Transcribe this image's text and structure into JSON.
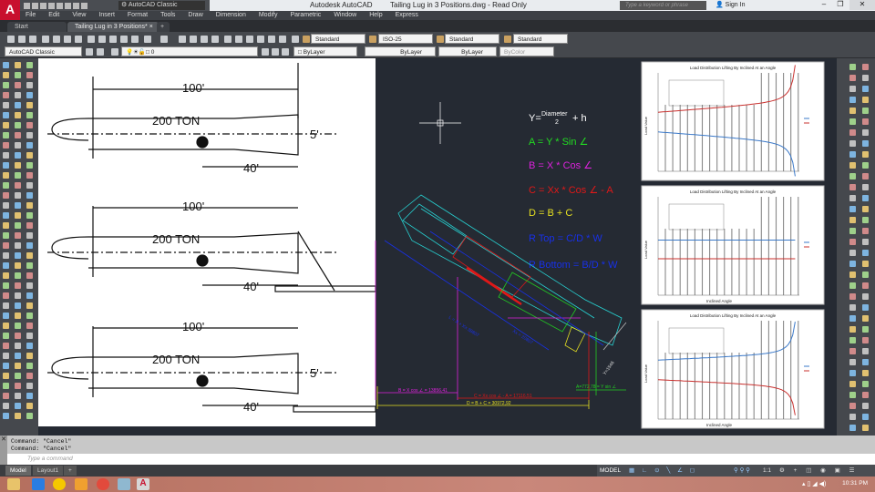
{
  "title_bar": {
    "workspace": "AutoCAD Classic",
    "app_title": "Autodesk AutoCAD",
    "doc_title": "Tailing Lug in 3 Positions.dwg - Read Only",
    "search_placeholder": "Type a keyword or phrase",
    "sign_in": "Sign In",
    "minimize": "–",
    "restore": "❐",
    "close": "✕"
  },
  "menu": [
    "File",
    "Edit",
    "View",
    "Insert",
    "Format",
    "Tools",
    "Draw",
    "Dimension",
    "Modify",
    "Parametric",
    "Window",
    "Help",
    "Express"
  ],
  "tabs": {
    "start": "Start",
    "active": "Tailing Lug in 3 Positions*",
    "close": "×",
    "add": "+"
  },
  "toolbar": {
    "text_style": "Standard",
    "dim_style": "ISO-25",
    "table_style": "Standard",
    "mleader_style": "Standard",
    "workspace": "AutoCAD Classic",
    "layer": "0",
    "color": "ByLayer",
    "linetype": "ByLayer",
    "lineweight": "ByLayer",
    "plot_style": "ByColor"
  },
  "drawing": {
    "dim_100": "100'",
    "dim_40": "40'",
    "dim_5": "5'",
    "load_label": "200 TON",
    "formulas": {
      "y": "Y=",
      "y_num": "Diameter",
      "y_den": "2",
      "y_tail": "+ h",
      "a": "A = Y * Sin ∠",
      "b": "B = X * Cos ∠",
      "c": "C = Xx * Cos ∠  -  A",
      "d": "D = B + C",
      "rtop": "R Top = C/D * W",
      "rbottom": "R Bottom = B/D * W"
    },
    "dims": {
      "a": "A=772,78 = Y sin ∠",
      "b": "B = X cos ∠ = 13856,41",
      "c": "C = Xx cos ∠ - A = 17116,51",
      "d": "D = B + C = 30972,92",
      "l": "L = X + Xx  38807",
      "xx": "Xx = 20807",
      "y": "Y=1546"
    }
  },
  "charts": {
    "title": "Load Distribution Lifting By Inclined At an Angle",
    "ylabel": "Load Value",
    "xlabel": "Inclined Angle"
  },
  "colors": {
    "top_series": "#3a78c8",
    "bottom_series": "#c8302e",
    "canvas": "#252a33"
  },
  "command": {
    "history": [
      "Command: \"Cancel\"",
      "Command: \"Cancel\""
    ],
    "placeholder": "Type a command"
  },
  "layout_tabs": [
    "Model",
    "Layout1",
    "+"
  ],
  "status": {
    "mode": "MODEL",
    "scale": "1:1"
  },
  "taskbar": {
    "time": "10:31 PM"
  }
}
